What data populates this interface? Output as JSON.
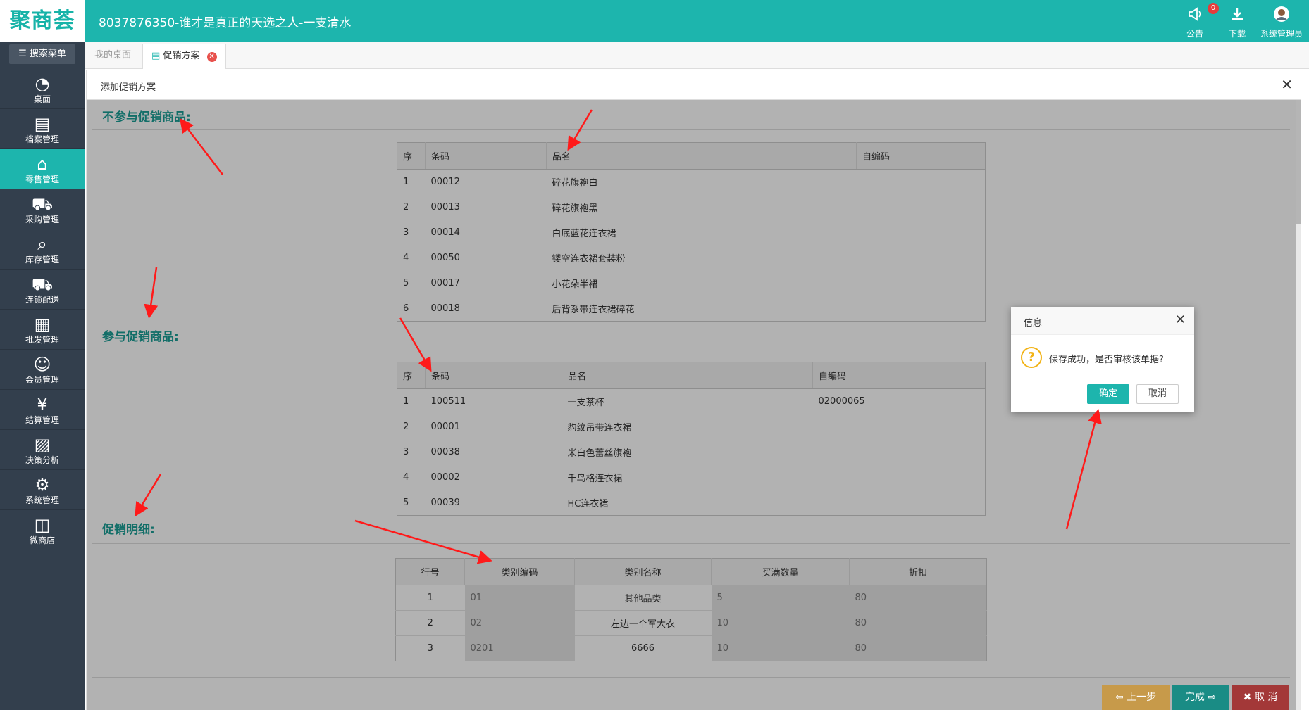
{
  "app": {
    "logo": "聚商荟",
    "title": "8037876350-谁才是真正的天选之人-一支清水",
    "notice_label": "公告",
    "notice_count": "0",
    "download_label": "下载",
    "user_label": "系统管理员"
  },
  "sidebar": {
    "search_label": "搜索菜单",
    "items": [
      {
        "label": "桌面",
        "icon": "dashboard-icon"
      },
      {
        "label": "档案管理",
        "icon": "archive-icon"
      },
      {
        "label": "零售管理",
        "icon": "store-icon"
      },
      {
        "label": "采购管理",
        "icon": "cart-icon"
      },
      {
        "label": "库存管理",
        "icon": "inventory-search-icon"
      },
      {
        "label": "连锁配送",
        "icon": "truck-icon"
      },
      {
        "label": "批发管理",
        "icon": "wholesale-icon"
      },
      {
        "label": "会员管理",
        "icon": "member-icon"
      },
      {
        "label": "结算管理",
        "icon": "settlement-icon"
      },
      {
        "label": "决策分析",
        "icon": "chart-icon"
      },
      {
        "label": "系统管理",
        "icon": "gear-icon"
      },
      {
        "label": "微商店",
        "icon": "shop-bag-icon"
      }
    ]
  },
  "tabs": [
    {
      "label": "我的桌面"
    },
    {
      "label": "促销方案"
    }
  ],
  "window": {
    "title": "添加促销方案"
  },
  "excluded": {
    "title": "不参与促销商品:",
    "headers": [
      "序",
      "条码",
      "品名",
      "自编码"
    ],
    "rows": [
      [
        "1",
        "00012",
        "碎花旗袍白",
        ""
      ],
      [
        "2",
        "00013",
        "碎花旗袍黑",
        ""
      ],
      [
        "3",
        "00014",
        "白底蓝花连衣裙",
        ""
      ],
      [
        "4",
        "00050",
        "镂空连衣裙套装粉",
        ""
      ],
      [
        "5",
        "00017",
        "小花朵半裙",
        ""
      ],
      [
        "6",
        "00018",
        "后背系带连衣裙碎花",
        ""
      ]
    ]
  },
  "included": {
    "title": "参与促销商品:",
    "headers": [
      "序",
      "条码",
      "品名",
      "自编码"
    ],
    "rows": [
      [
        "1",
        "100511",
        "一支茶杯",
        "02000065"
      ],
      [
        "2",
        "00001",
        "豹纹吊带连衣裙",
        ""
      ],
      [
        "3",
        "00038",
        "米白色蕾丝旗袍",
        ""
      ],
      [
        "4",
        "00002",
        "千鸟格连衣裙",
        ""
      ],
      [
        "5",
        "00039",
        "HC连衣裙",
        ""
      ]
    ]
  },
  "details": {
    "title": "促销明细:",
    "headers": [
      "行号",
      "类别编码",
      "类别名称",
      "买满数量",
      "折扣"
    ],
    "rows": [
      [
        "1",
        "01",
        "其他品类",
        "5",
        "80"
      ],
      [
        "2",
        "02",
        "左边一个军大衣",
        "10",
        "80"
      ],
      [
        "3",
        "0201",
        "6666",
        "10",
        "80"
      ]
    ]
  },
  "footer": {
    "prev": "上一步",
    "finish": "完成",
    "cancel": "取 消"
  },
  "dialog": {
    "title": "信息",
    "message": "保存成功，是否审核该单据?",
    "ok": "确定",
    "cancel": "取消"
  },
  "colors": {
    "brand": "#1db5ad",
    "sidebar": "#333f4d",
    "annotation": "#ff1a1a"
  }
}
